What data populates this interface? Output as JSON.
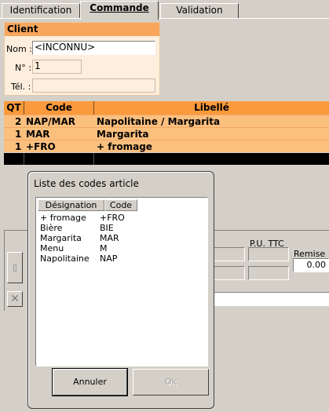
{
  "tabs": [
    {
      "label": "Identification"
    },
    {
      "label": "Commande"
    },
    {
      "label": "Validation"
    }
  ],
  "client": {
    "title": "Client",
    "nom_label": "Nom :",
    "nom_value": "<INCONNU>",
    "num_label": "N° :",
    "num_value": "1",
    "tel_label": "Tél. :",
    "tel_value": ""
  },
  "grid": {
    "headers": {
      "qt": "QT",
      "code": "Code",
      "libelle": "Libellé"
    },
    "rows": [
      {
        "qt": "2",
        "code": "NAP/MAR",
        "libelle": "Napolitaine / Margarita"
      },
      {
        "qt": "1",
        "code": "MAR",
        "libelle": "Margarita"
      },
      {
        "qt": "1",
        "code": "+FRO",
        "libelle": "+ fromage"
      }
    ]
  },
  "lower": {
    "pu_label": "P.U. TTC",
    "remise_label": "Remise",
    "remise_value": "0.00"
  },
  "dialog": {
    "title": "Liste des codes article",
    "headers": {
      "designation": "Désignation",
      "code": "Code"
    },
    "items": [
      {
        "designation": "+ fromage",
        "code": "+FRO"
      },
      {
        "designation": "Bière",
        "code": "BIE"
      },
      {
        "designation": "Margarita",
        "code": "MAR"
      },
      {
        "designation": "Menu",
        "code": "M"
      },
      {
        "designation": "Napolitaine",
        "code": "NAP"
      }
    ],
    "cancel_label": "Annuler",
    "ok_label": "Ok"
  },
  "colors": {
    "accent_orange": "#f7a65c",
    "row_orange": "#fbbf7e",
    "panel_bg": "#d4d0c8"
  }
}
